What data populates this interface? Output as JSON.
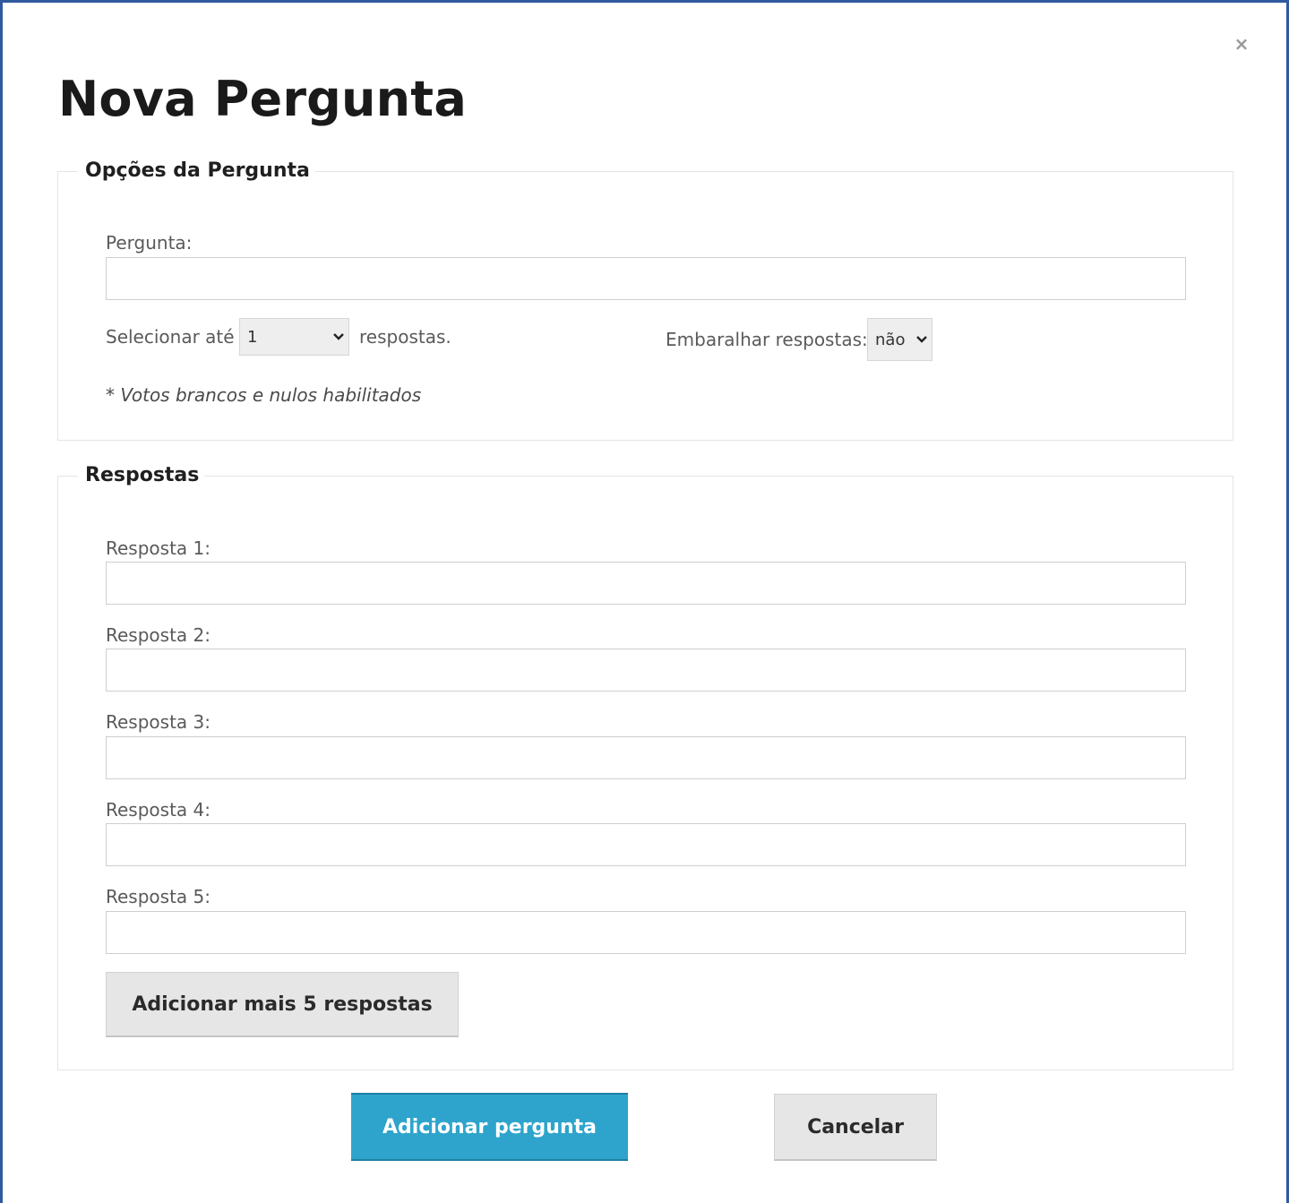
{
  "dialog": {
    "title": "Nova Pergunta",
    "close_icon": "close-icon",
    "close_glyph": "×"
  },
  "options": {
    "legend": "Opções da Pergunta",
    "question_label": "Pergunta:",
    "question_value": "",
    "select_prefix": "Selecionar até",
    "select_value": "1",
    "select_suffix": "respostas.",
    "shuffle_label": "Embaralhar respostas:",
    "shuffle_value": "não",
    "note": "* Votos brancos e nulos habilitados"
  },
  "answers": {
    "legend": "Respostas",
    "items": [
      {
        "label": "Resposta 1:",
        "value": ""
      },
      {
        "label": "Resposta 2:",
        "value": ""
      },
      {
        "label": "Resposta 3:",
        "value": ""
      },
      {
        "label": "Resposta 4:",
        "value": ""
      },
      {
        "label": "Resposta 5:",
        "value": ""
      }
    ],
    "add_more_label": "Adicionar mais 5 respostas"
  },
  "footer": {
    "submit_label": "Adicionar pergunta",
    "cancel_label": "Cancelar"
  },
  "colors": {
    "primary": "#2ea4cc",
    "frame": "#2f5a9e",
    "button_gray": "#e6e6e6"
  }
}
